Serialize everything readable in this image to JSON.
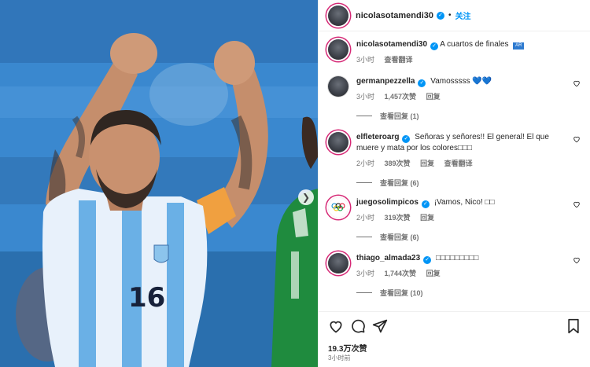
{
  "post": {
    "username": "nicolasotamendi30",
    "follow_label": "关注",
    "caption": "A cuartos de finales",
    "caption_flag": "AR",
    "time": "3小时",
    "see_translation": "查看翻译",
    "likes": "19.3万次赞",
    "posted_time": "3小时前"
  },
  "comments": [
    {
      "username": "germanpezzella",
      "text": "Vamosssss 💙💙",
      "time": "3小时",
      "likes": "1,457次赞",
      "reply": "回复",
      "view_replies": "查看回复 (1)"
    },
    {
      "username": "elfleteroarg",
      "text": "Señoras y señores!! El general! El que muere y mata por los colores□□□",
      "time": "2小时",
      "likes": "389次赞",
      "reply": "回复",
      "translate": "查看翻译",
      "view_replies": "查看回复 (6)"
    },
    {
      "username": "juegosolimpicos",
      "text": "¡Vamos, Nico! □□",
      "time": "2小时",
      "likes": "319次赞",
      "reply": "回复",
      "view_replies": "查看回复 (6)"
    },
    {
      "username": "thiago_almada23",
      "text": "□□□□□□□□□",
      "time": "3小时",
      "likes": "1,744次赞",
      "reply": "回复",
      "view_replies": "查看回复 (10)"
    }
  ],
  "photo": {
    "jersey_number": "16"
  },
  "colors": {
    "link": "#0095f6",
    "story_ring": "#d62976",
    "muted": "#737373"
  },
  "icons": [
    "heart-icon",
    "comment-icon",
    "share-icon",
    "bookmark-icon",
    "verified-icon",
    "next-arrow-icon"
  ]
}
